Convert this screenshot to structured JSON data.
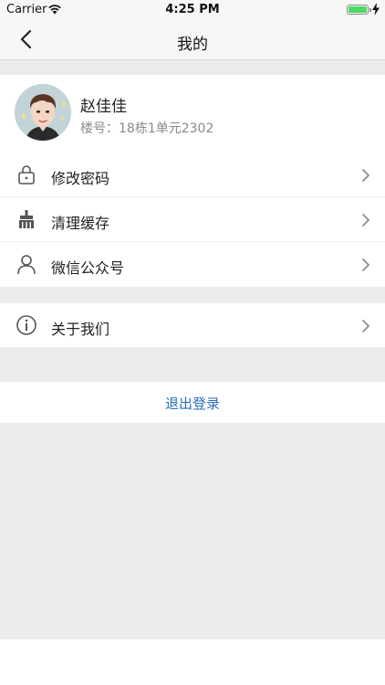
{
  "status_bar": {
    "carrier": "Carrier",
    "time": "4:25 PM",
    "battery_level": 1.0
  },
  "nav": {
    "title": "我的"
  },
  "profile": {
    "name": "赵佳佳",
    "address": "楼号：18栋1单元2302"
  },
  "menu_group_1": [
    {
      "label": "修改密码",
      "icon": "lock-icon"
    },
    {
      "label": "清理缓存",
      "icon": "broom-icon"
    },
    {
      "label": "微信公众号",
      "icon": "person-icon"
    }
  ],
  "menu_group_2": [
    {
      "label": "关于我们",
      "icon": "info-icon"
    }
  ],
  "logout": {
    "label": "退出登录"
  },
  "colors": {
    "accent": "#2b6fb8",
    "background": "#ececec",
    "battery": "#4cd964"
  }
}
